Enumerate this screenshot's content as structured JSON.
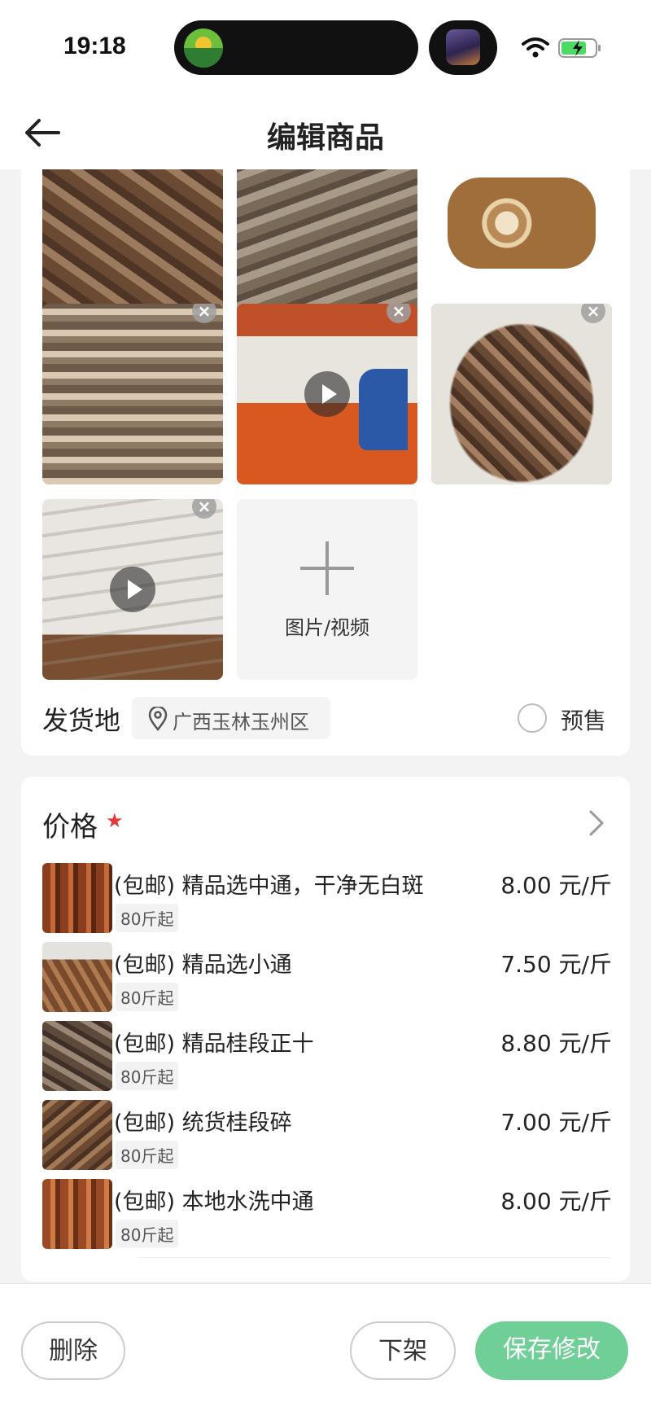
{
  "status_bar": {
    "time": "19:18"
  },
  "header": {
    "title": "编辑商品"
  },
  "media": {
    "add_label": "图片/视频",
    "items": [
      {
        "type": "image",
        "icon": "cinnamon-pile-photo"
      },
      {
        "type": "image",
        "icon": "cinnamon-sticks-photo"
      },
      {
        "type": "image",
        "icon": "cinnamon-roll-photo"
      },
      {
        "type": "image",
        "icon": "cinnamon-box-photo"
      },
      {
        "type": "video",
        "icon": "warehouse-video"
      },
      {
        "type": "image",
        "icon": "cinnamon-sack-photo"
      },
      {
        "type": "video",
        "icon": "bales-video"
      }
    ]
  },
  "shipping": {
    "label": "发货地",
    "location": "广西玉林玉州区",
    "presale_label": "预售"
  },
  "price": {
    "title": "价格",
    "star": "★",
    "rows": [
      {
        "name": "(包邮) 精品选中通，干净无白斑",
        "min": "80斤起",
        "price": "8.00 元/斤"
      },
      {
        "name": "(包邮) 精品选小通",
        "min": "80斤起",
        "price": "7.50 元/斤"
      },
      {
        "name": "(包邮) 精品桂段正十",
        "min": "80斤起",
        "price": "8.80 元/斤"
      },
      {
        "name": "(包邮) 统货桂段碎",
        "min": "80斤起",
        "price": "7.00 元/斤"
      },
      {
        "name": "(包邮) 本地水洗中通",
        "min": "80斤起",
        "price": "8.00 元/斤"
      }
    ]
  },
  "actions": {
    "delete_label": "删除",
    "offshelf_label": "下架",
    "save_label": "保存修改"
  },
  "colors": {
    "accent": "#6fcf97",
    "star": "#e53935"
  }
}
